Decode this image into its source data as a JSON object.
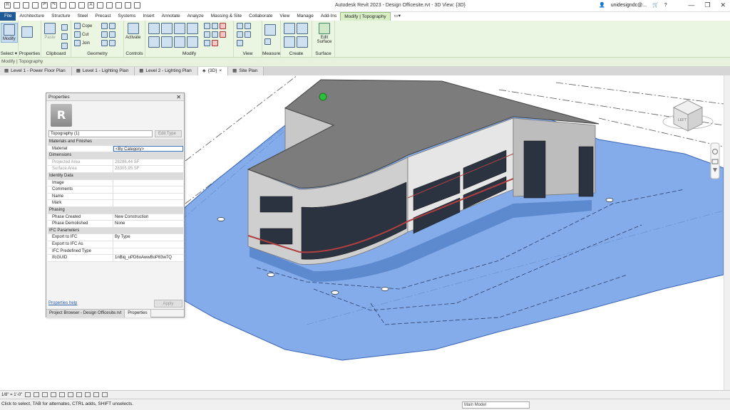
{
  "window": {
    "title": "Autodesk Revit 2023 - Design Officesite.rvt - 3D View: {3D}",
    "user": "unidesigndc@..."
  },
  "ribbon_tabs": [
    "File",
    "Architecture",
    "Structure",
    "Steel",
    "Precast",
    "Systems",
    "Insert",
    "Annotate",
    "Analyze",
    "Massing & Site",
    "Collaborate",
    "View",
    "Manage",
    "Add-Ins",
    "Modify | Topography"
  ],
  "ribbon": {
    "select_panel": {
      "modify": "Modify",
      "label": "Select ▾"
    },
    "properties_panel": {
      "label": "Properties"
    },
    "clipboard_panel": {
      "paste": "Paste",
      "label": "Clipboard"
    },
    "geometry_panel": {
      "cope": "Cope",
      "cut": "Cut",
      "join": "Join",
      "label": "Geometry"
    },
    "controls_panel": {
      "activate": "Activate",
      "label": "Controls"
    },
    "modify_panel": {
      "label": "Modify"
    },
    "view_panel": {
      "label": "View"
    },
    "measure_panel": {
      "label": "Measure"
    },
    "create_panel": {
      "label": "Create"
    },
    "surface_panel": {
      "edit_surface": "Edit Surface",
      "label": "Surface"
    }
  },
  "context_bar": "Modify | Topography",
  "view_tabs": [
    {
      "label": "Level 1 - Power Floor Plan"
    },
    {
      "label": "Level 1 - Lighting Plan"
    },
    {
      "label": "Level 2 - Lighting Plan"
    },
    {
      "label": "{3D}"
    },
    {
      "label": "Site Plan"
    }
  ],
  "properties": {
    "title": "Properties",
    "type_selector": "Topography (1)",
    "edit_type": "Edit Type",
    "rows": [
      {
        "kind": "group",
        "k": "Materials and Finishes",
        "v": ""
      },
      {
        "kind": "field",
        "k": "Material",
        "v": "<By Category>",
        "selected": true
      },
      {
        "kind": "group",
        "k": "Dimensions",
        "v": ""
      },
      {
        "kind": "readonly",
        "k": "Projected Area",
        "v": "28286.44 SF"
      },
      {
        "kind": "readonly",
        "k": "Surface Area",
        "v": "28305.95 SF"
      },
      {
        "kind": "group",
        "k": "Identity Data",
        "v": ""
      },
      {
        "kind": "field",
        "k": "Image",
        "v": ""
      },
      {
        "kind": "field",
        "k": "Comments",
        "v": ""
      },
      {
        "kind": "field",
        "k": "Name",
        "v": ""
      },
      {
        "kind": "field",
        "k": "Mark",
        "v": ""
      },
      {
        "kind": "group",
        "k": "Phasing",
        "v": ""
      },
      {
        "kind": "field",
        "k": "Phase Created",
        "v": "New Construction"
      },
      {
        "kind": "field",
        "k": "Phase Demolished",
        "v": "None"
      },
      {
        "kind": "group",
        "k": "IFC Parameters",
        "v": ""
      },
      {
        "kind": "field",
        "k": "Export to IFC",
        "v": "By Type"
      },
      {
        "kind": "field",
        "k": "Export to IFC As",
        "v": ""
      },
      {
        "kind": "field",
        "k": "IFC Predefined Type",
        "v": ""
      },
      {
        "kind": "field",
        "k": "IfcGUID",
        "v": "1nBiq_uPD6oAwwBoP83w7Q"
      }
    ],
    "help": "Properties help",
    "apply": "Apply",
    "bottom_tabs": [
      "Project Browser - Design Officesite.rvt",
      "Properties"
    ]
  },
  "view_control_bar": {
    "scale": "1/8\" = 1'-0\""
  },
  "status": {
    "message": "Click to select, TAB for alternates, CTRL adds, SHIFT unselects.",
    "model": "Main Model"
  },
  "colors": {
    "file_tab": "#1f5a96",
    "ribbon_bg": "#eaf6e1",
    "topography": "#6f9ee6",
    "roof": "#7c7c7c",
    "brick": "#c7c7c7"
  }
}
